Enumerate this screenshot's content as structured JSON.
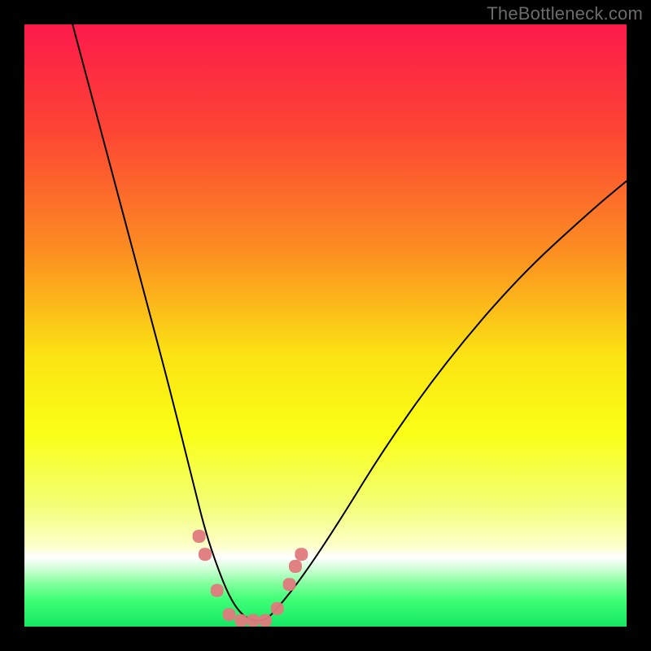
{
  "watermark": "TheBottleneck.com",
  "colors": {
    "frame": "#000000",
    "gradient_stops": [
      {
        "offset": 0.0,
        "color": "#fd1a4b"
      },
      {
        "offset": 0.18,
        "color": "#fd4634"
      },
      {
        "offset": 0.38,
        "color": "#fc8f21"
      },
      {
        "offset": 0.55,
        "color": "#fbe313"
      },
      {
        "offset": 0.68,
        "color": "#faff16"
      },
      {
        "offset": 0.8,
        "color": "#f3ff78"
      },
      {
        "offset": 0.865,
        "color": "#fdffc8"
      },
      {
        "offset": 0.885,
        "color": "#ffffff"
      },
      {
        "offset": 0.905,
        "color": "#cdffd3"
      },
      {
        "offset": 0.93,
        "color": "#7eff9a"
      },
      {
        "offset": 0.955,
        "color": "#3fff77"
      },
      {
        "offset": 1.0,
        "color": "#14e763"
      }
    ],
    "curve": "#000000",
    "marker": "#e07a7d"
  },
  "chart_data": {
    "type": "line",
    "title": "",
    "xlabel": "",
    "ylabel": "",
    "xlim": [
      0,
      100
    ],
    "ylim": [
      0,
      100
    ],
    "notes": "V-shaped bottleneck curve; y≈0 around x≈33–40, rising steeply toward both x extremes. Pink rounded markers cluster near the trough.",
    "series": [
      {
        "name": "bottleneck-curve",
        "x": [
          8,
          12,
          16,
          20,
          24,
          28,
          30,
          32,
          34,
          36,
          38,
          40,
          42,
          46,
          52,
          60,
          70,
          82,
          94,
          100
        ],
        "y": [
          100,
          85,
          70,
          55,
          40,
          24,
          16,
          10,
          5,
          2,
          1,
          1,
          3,
          8,
          17,
          30,
          44,
          58,
          69,
          74
        ]
      }
    ],
    "markers": {
      "name": "highlight-points",
      "points": [
        {
          "x": 29,
          "y": 15
        },
        {
          "x": 30,
          "y": 12
        },
        {
          "x": 32,
          "y": 6
        },
        {
          "x": 34,
          "y": 2
        },
        {
          "x": 36,
          "y": 1
        },
        {
          "x": 38,
          "y": 1
        },
        {
          "x": 40,
          "y": 1
        },
        {
          "x": 42,
          "y": 3
        },
        {
          "x": 44,
          "y": 7
        },
        {
          "x": 45,
          "y": 10
        },
        {
          "x": 46,
          "y": 12
        }
      ]
    }
  }
}
